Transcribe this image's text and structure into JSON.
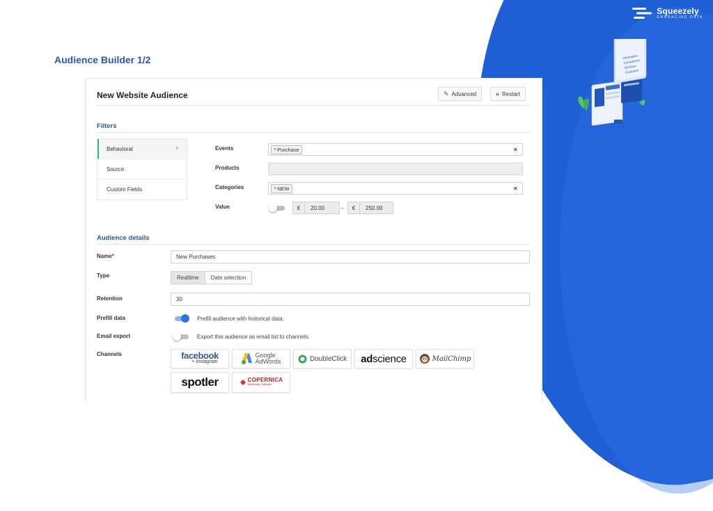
{
  "slide": {
    "title": "Audience Builder 1/2",
    "brand": {
      "name": "Squeezely",
      "tagline": "EMBRACING DATA"
    },
    "illustration": {
      "list_items": [
        "Orientation",
        "Comparison",
        "Decision",
        "Customer"
      ]
    }
  },
  "header": {
    "title": "New Website Audience",
    "advanced_label": "Advanced",
    "advanced_icon": "magic-wand-icon",
    "restart_label": "Restart",
    "restart_icon": "double-chevron-left-icon"
  },
  "filters": {
    "title": "Filters",
    "menu": [
      {
        "label": "Behavioral",
        "active": true
      },
      {
        "label": "Source",
        "active": false
      },
      {
        "label": "Custom Fields",
        "active": false
      }
    ],
    "events": {
      "label": "Events",
      "tags": [
        "Purchase"
      ]
    },
    "products": {
      "label": "Products",
      "tags": []
    },
    "categories": {
      "label": "Categories",
      "tags": [
        "NEW"
      ]
    },
    "value": {
      "label": "Value",
      "enabled": false,
      "currency": "€",
      "min": "20.00",
      "separator": "-",
      "max": "250.00"
    }
  },
  "audience": {
    "title": "Audience details",
    "name": {
      "label": "Name",
      "required_mark": "*",
      "value": "New Purchases"
    },
    "type": {
      "label": "Type",
      "options": [
        "Realtime",
        "Date selection"
      ],
      "selected": "Realtime"
    },
    "retention": {
      "label": "Retention",
      "value": "30"
    },
    "prefill": {
      "label": "Prefill data",
      "enabled": true,
      "text": "Prefill audience with historical data."
    },
    "email_export": {
      "label": "Email export",
      "enabled": false,
      "text": "Export this audience as email list to channels."
    },
    "channels": {
      "label": "Channels",
      "facebook": {
        "name": "facebook",
        "sub": "+ Instagram",
        "color": "#3b5998"
      },
      "google": {
        "name_top": "Google",
        "name_bottom": "AdWords"
      },
      "doubleclick": {
        "name": "DoubleClick"
      },
      "adscience": {
        "part1": "ad",
        "part2": "science"
      },
      "mailchimp": {
        "name": "MailChimp"
      },
      "spotler": {
        "name": "spotler"
      },
      "copernica": {
        "name": "COPERNICA",
        "sub": "Marketing Software"
      }
    }
  },
  "colors": {
    "accent_blue": "#2a57a8",
    "toggle_on": "#2f74e0",
    "active_marker": "#2cb87a",
    "brand_blue": "#1f5fd6"
  }
}
